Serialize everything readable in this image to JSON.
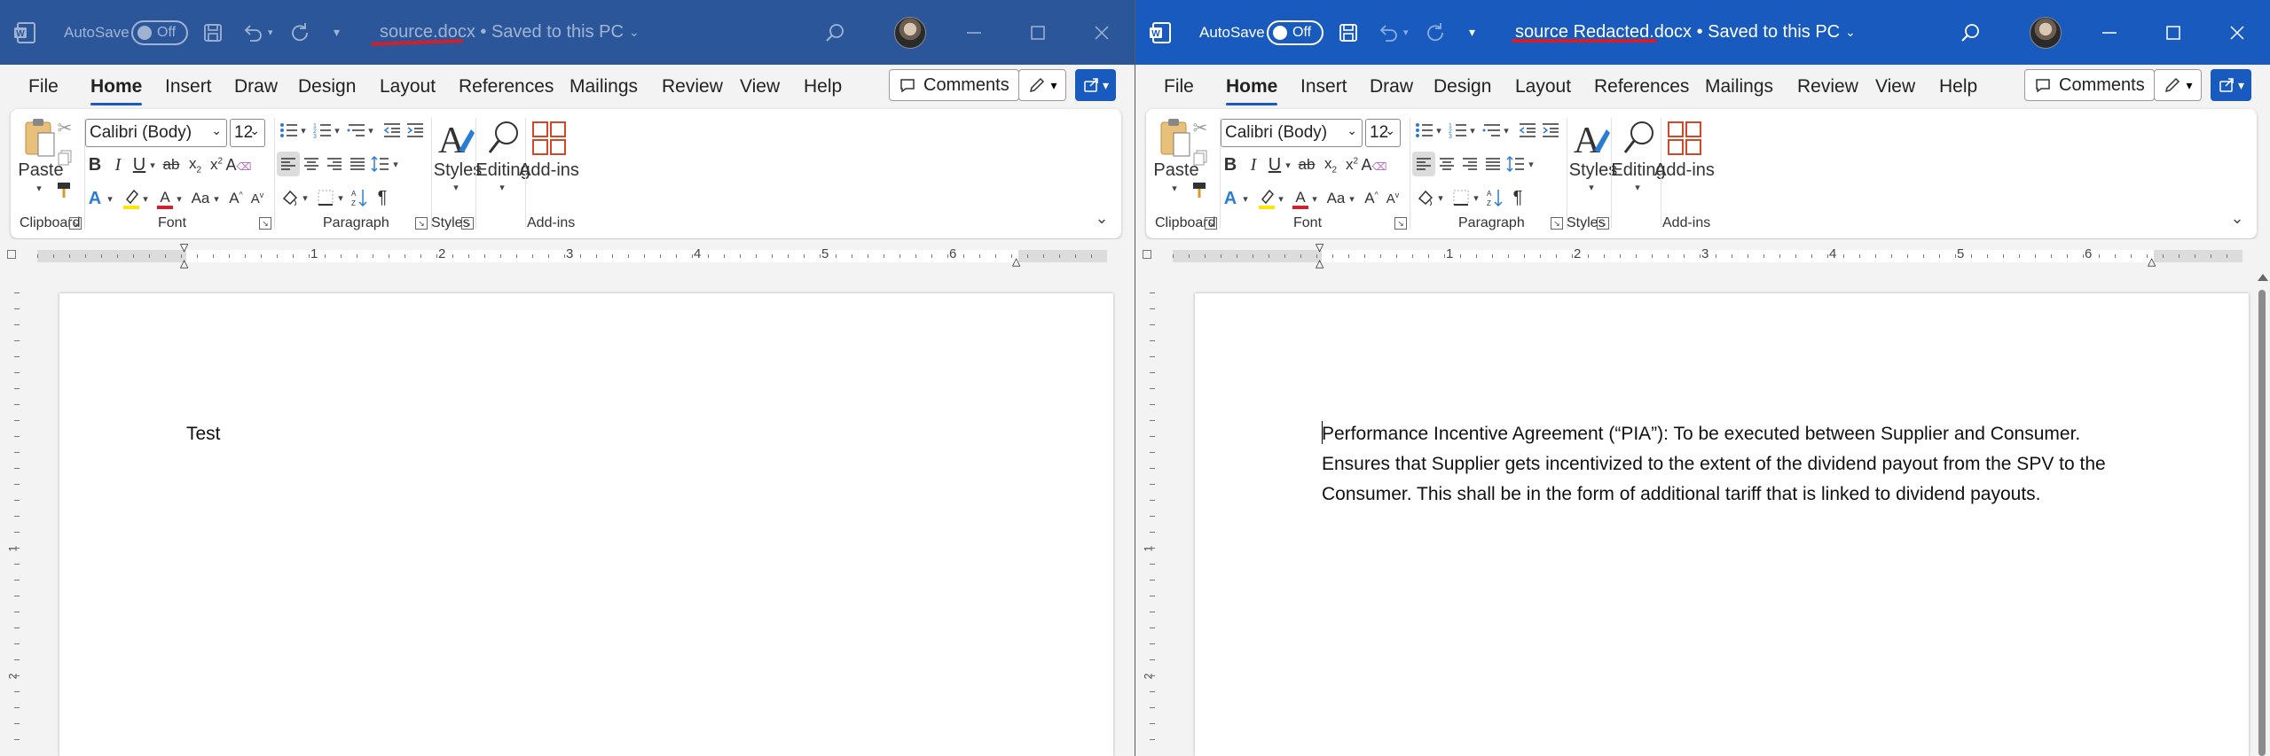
{
  "left": {
    "app_icon": "word-icon",
    "autosave_label": "AutoSave",
    "autosave_state": "Off",
    "doc_name": "source.docx",
    "save_status": "Saved to this PC",
    "menu": [
      "File",
      "Home",
      "Insert",
      "Draw",
      "Design",
      "Layout",
      "References",
      "Mailings",
      "Review",
      "View",
      "Help"
    ],
    "comments_label": "Comments",
    "font_name": "Calibri (Body)",
    "font_size": "12",
    "paste_label": "Paste",
    "styles_label": "Styles",
    "editing_label": "Editing",
    "addins_label": "Add-ins",
    "groups": {
      "clipboard": "Clipboard",
      "font": "Font",
      "paragraph": "Paragraph",
      "styles": "Styles",
      "addins": "Add-ins"
    },
    "ruler_numbers": [
      "1",
      "2",
      "3",
      "4",
      "5",
      "6"
    ],
    "vruler_numbers": [
      "1",
      "2"
    ],
    "body_text": "Test"
  },
  "right": {
    "app_icon": "word-icon",
    "autosave_label": "AutoSave",
    "autosave_state": "Off",
    "doc_name": "source Redacted.docx",
    "save_status": "Saved to this PC",
    "menu": [
      "File",
      "Home",
      "Insert",
      "Draw",
      "Design",
      "Layout",
      "References",
      "Mailings",
      "Review",
      "View",
      "Help"
    ],
    "comments_label": "Comments",
    "font_name": "Calibri (Body)",
    "font_size": "12",
    "paste_label": "Paste",
    "styles_label": "Styles",
    "editing_label": "Editing",
    "addins_label": "Add-ins",
    "groups": {
      "clipboard": "Clipboard",
      "font": "Font",
      "paragraph": "Paragraph",
      "styles": "Styles",
      "addins": "Add-ins"
    },
    "ruler_numbers": [
      "1",
      "2",
      "3",
      "4",
      "5",
      "6"
    ],
    "vruler_numbers": [
      "1",
      "2"
    ],
    "body_lines": [
      "Performance Incentive Agreement (“PIA”): To be executed between Supplier and Consumer.",
      "Ensures that Supplier gets incentivized to the extent of the dividend payout from the SPV to the",
      "Consumer. This shall be in the form of additional tariff that is linked to dividend payouts."
    ]
  },
  "colors": {
    "title_left": "#2b579a",
    "title_right": "#185abd",
    "annotation_red": "#d0202b",
    "highlight_yellow": "#ffe600",
    "font_color_red": "#d0202b",
    "addins_orange": "#d24726"
  }
}
